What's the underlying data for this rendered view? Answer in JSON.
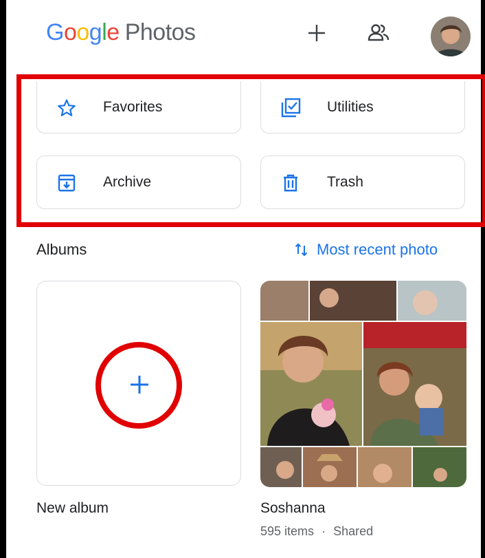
{
  "header": {
    "logo_parts": [
      "G",
      "o",
      "o",
      "g",
      "l",
      "e"
    ],
    "logo_product": "Photos",
    "add_icon": "plus-icon",
    "sharing_icon": "people-icon",
    "avatar_icon": "account-avatar"
  },
  "shortcuts": [
    {
      "label": "Favorites",
      "icon": "star-outline-icon"
    },
    {
      "label": "Utilities",
      "icon": "utilities-checklist-icon"
    },
    {
      "label": "Archive",
      "icon": "archive-icon"
    },
    {
      "label": "Trash",
      "icon": "trash-icon"
    }
  ],
  "albums": {
    "title": "Albums",
    "sort_label": "Most recent photo",
    "sort_icon": "sort-arrows-icon",
    "items": [
      {
        "name": "New album",
        "icon": "plus-icon"
      },
      {
        "name": "Soshanna",
        "items_count": "595 items",
        "separator": "·",
        "shared": "Shared"
      }
    ]
  },
  "colors": {
    "google_blue": "#4285F4",
    "google_red": "#EA4335",
    "google_yellow": "#FBBC05",
    "google_green": "#34A853",
    "accent": "#1a73e8",
    "annotation_red": "#e00000"
  }
}
